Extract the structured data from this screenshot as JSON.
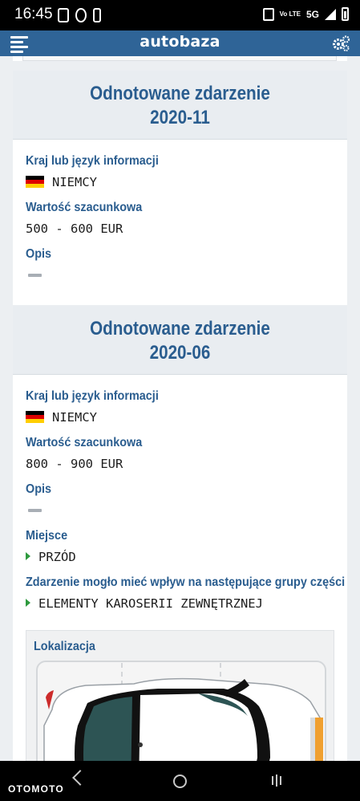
{
  "status_bar": {
    "time": "16:45",
    "network": "5G",
    "volte": "Vo LTE"
  },
  "header": {
    "logo_text": "autobaza",
    "menu_icon": "hamburger-menu-icon",
    "settings_icon": "gears-icon",
    "accent": "#2f6497"
  },
  "events": [
    {
      "title": "Odnotowane zdarzenie",
      "date": "2020-11",
      "country_label": "Kraj lub język informacji",
      "country_value": "NIEMCY",
      "estimate_label": "Wartość szacunkowa",
      "estimate_value": "500 - 600 EUR",
      "desc_label": "Opis"
    },
    {
      "title": "Odnotowane zdarzenie",
      "date": "2020-06",
      "country_label": "Kraj lub język informacji",
      "country_value": "NIEMCY",
      "estimate_label": "Wartość szacunkowa",
      "estimate_value": "800 - 900 EUR",
      "desc_label": "Opis",
      "place_label": "Miejsce",
      "place_value": "PRZÓD",
      "parts_label": "Zdarzenie mogło mieć wpływ na następujące grupy części",
      "parts_value": "ELEMENTY KAROSERII ZEWNĘTRZNEJ",
      "location_label": "Lokalizacja"
    }
  ],
  "colors": {
    "label_blue": "#2a5d8f",
    "arrow_green": "#2e9a3e",
    "highlight_orange": "#f0a030"
  },
  "nav_bar": {
    "brand": "OTOMOTO"
  }
}
